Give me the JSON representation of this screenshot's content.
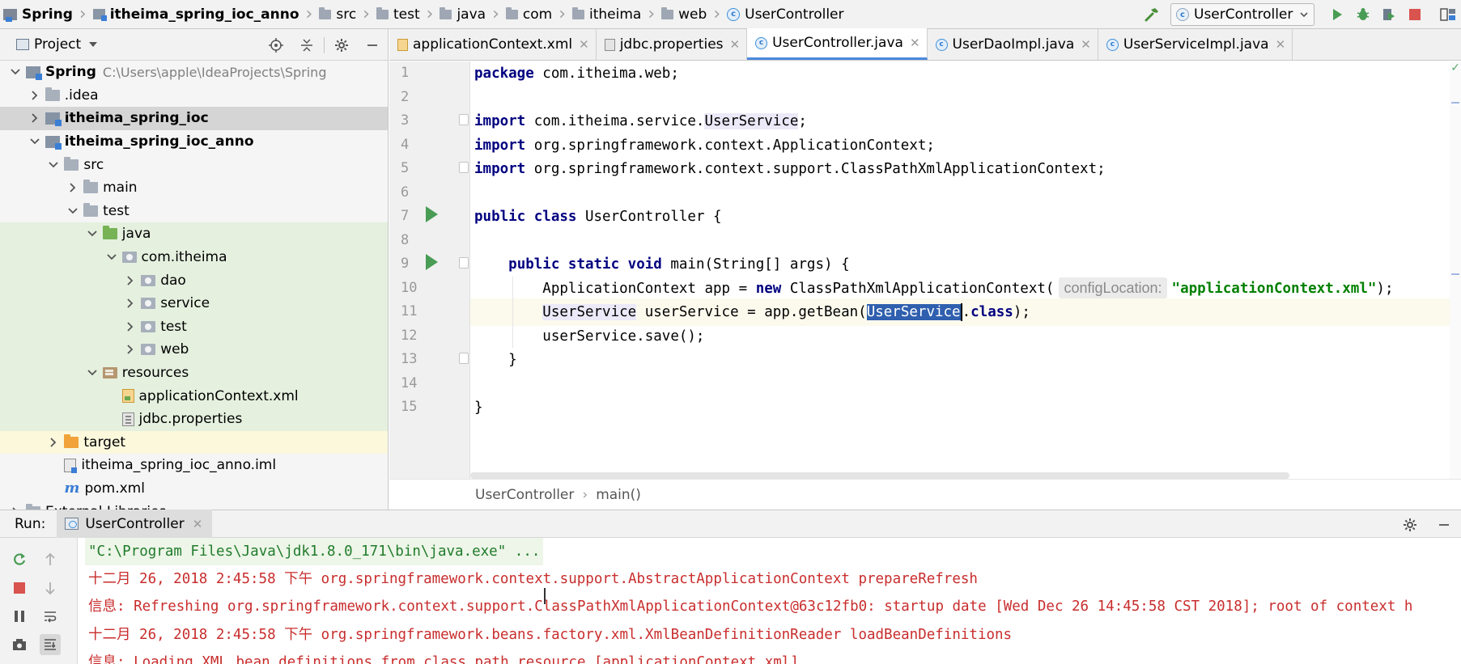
{
  "breadcrumbs": [
    {
      "label": "Spring",
      "bold": true,
      "icon": "spring-project-icon"
    },
    {
      "label": "itheima_spring_ioc_anno",
      "bold": true,
      "icon": "module-icon"
    },
    {
      "label": "src",
      "icon": "folder-icon"
    },
    {
      "label": "test",
      "icon": "folder-icon"
    },
    {
      "label": "java",
      "icon": "folder-icon"
    },
    {
      "label": "com",
      "icon": "folder-icon"
    },
    {
      "label": "itheima",
      "icon": "folder-icon"
    },
    {
      "label": "web",
      "icon": "folder-icon"
    },
    {
      "label": "UserController",
      "icon": "class-icon"
    }
  ],
  "run_config": {
    "selected": "UserController"
  },
  "project_panel": {
    "title": "Project"
  },
  "project_tree": [
    {
      "label": "Spring",
      "depth": 0,
      "expanded": true,
      "icon": "spring",
      "bold": true,
      "path": "C:\\Users\\apple\\IdeaProjects\\Spring"
    },
    {
      "label": ".idea",
      "depth": 1,
      "expanded": false,
      "icon": "grey"
    },
    {
      "label": "itheima_spring_ioc",
      "depth": 1,
      "expanded": false,
      "icon": "module",
      "bold": true,
      "state": "selected"
    },
    {
      "label": "itheima_spring_ioc_anno",
      "depth": 1,
      "expanded": true,
      "icon": "module",
      "bold": true
    },
    {
      "label": "src",
      "depth": 2,
      "expanded": true,
      "icon": "grey"
    },
    {
      "label": "main",
      "depth": 3,
      "expanded": false,
      "icon": "grey"
    },
    {
      "label": "test",
      "depth": 3,
      "expanded": true,
      "icon": "grey"
    },
    {
      "label": "java",
      "depth": 4,
      "expanded": true,
      "icon": "green",
      "state": "green"
    },
    {
      "label": "com.itheima",
      "depth": 5,
      "expanded": true,
      "icon": "pkg",
      "state": "green"
    },
    {
      "label": "dao",
      "depth": 6,
      "expanded": false,
      "icon": "pkg",
      "state": "green"
    },
    {
      "label": "service",
      "depth": 6,
      "expanded": false,
      "icon": "pkg",
      "state": "green"
    },
    {
      "label": "test",
      "depth": 6,
      "expanded": false,
      "icon": "pkg",
      "state": "green"
    },
    {
      "label": "web",
      "depth": 6,
      "expanded": false,
      "icon": "pkg",
      "state": "green"
    },
    {
      "label": "resources",
      "depth": 4,
      "expanded": true,
      "icon": "res",
      "state": "green"
    },
    {
      "label": "applicationContext.xml",
      "depth": 5,
      "icon": "xml",
      "state": "green"
    },
    {
      "label": "jdbc.properties",
      "depth": 5,
      "icon": "prop",
      "state": "green"
    },
    {
      "label": "target",
      "depth": 2,
      "expanded": false,
      "icon": "orange",
      "state": "yellow"
    },
    {
      "label": "itheima_spring_ioc_anno.iml",
      "depth": 2,
      "icon": "iml"
    },
    {
      "label": "pom.xml",
      "depth": 2,
      "icon": "maven"
    },
    {
      "label": "External Libraries",
      "depth": 0,
      "expanded": false,
      "icon": "grey"
    }
  ],
  "editor_tabs": [
    {
      "label": "applicationContext.xml",
      "icon": "xml"
    },
    {
      "label": "jdbc.properties",
      "icon": "prop"
    },
    {
      "label": "UserController.java",
      "icon": "class",
      "active": true
    },
    {
      "label": "UserDaoImpl.java",
      "icon": "class"
    },
    {
      "label": "UserServiceImpl.java",
      "icon": "class"
    }
  ],
  "line_numbers": [
    "1",
    "2",
    "3",
    "4",
    "5",
    "6",
    "7",
    "8",
    "9",
    "10",
    "11",
    "12",
    "13",
    "14",
    "15"
  ],
  "code_lines": [
    [
      {
        "t": "package",
        "c": "kw"
      },
      {
        "t": " com.itheima.web;"
      }
    ],
    [],
    [
      {
        "t": "import",
        "c": "kw"
      },
      {
        "t": " com.itheima.service."
      },
      {
        "t": "UserService",
        "c": "usage"
      },
      {
        "t": ";"
      }
    ],
    [
      {
        "t": "import",
        "c": "kw"
      },
      {
        "t": " org.springframework.context.ApplicationContext;"
      }
    ],
    [
      {
        "t": "import",
        "c": "kw"
      },
      {
        "t": " org.springframework.context.support.ClassPathXmlApplicationContext;"
      }
    ],
    [],
    [
      {
        "t": "public class",
        "c": "kw"
      },
      {
        "t": " UserController {"
      }
    ],
    [],
    [
      {
        "t": "    "
      },
      {
        "t": "public static void",
        "c": "kw"
      },
      {
        "t": " main(String[] args) {"
      }
    ],
    [
      {
        "t": "        ApplicationContext app = "
      },
      {
        "t": "new",
        "c": "kw"
      },
      {
        "t": " ClassPathXmlApplicationContext("
      },
      {
        "t": "configLocation:",
        "c": "hint"
      },
      {
        "t": "\"applicationContext.xml\"",
        "c": "str"
      },
      {
        "t": ");"
      }
    ],
    [
      {
        "t": "        "
      },
      {
        "t": "UserService",
        "c": "usage"
      },
      {
        "t": " userService = app.getBean("
      },
      {
        "t": "UserService",
        "c": "sel"
      },
      {
        "t": "",
        "c": "caret"
      },
      {
        "t": "."
      },
      {
        "t": "class",
        "c": "kw"
      },
      {
        "t": ");"
      }
    ],
    [
      {
        "t": "        userService.save();"
      }
    ],
    [
      {
        "t": "    }"
      }
    ],
    [],
    [
      {
        "t": "}"
      }
    ]
  ],
  "editor_breadcrumb": [
    "UserController",
    "main()"
  ],
  "run_panel": {
    "label": "Run:",
    "tab": "UserController"
  },
  "console_lines": [
    {
      "text": "\"C:\\Program Files\\Java\\jdk1.8.0_171\\bin\\java.exe\" ...",
      "kind": "cmd"
    },
    {
      "text": "十二月 26, 2018 2:45:58 下午 org.springframework.context.support.AbstractApplicationContext prepareRefresh",
      "kind": "err"
    },
    {
      "text": "信息: Refreshing org.springframework.context.support.ClassPathXmlApplicationContext@63c12fb0: startup date [Wed Dec 26 14:45:58 CST 2018]; root of context h",
      "kind": "err"
    },
    {
      "text": "十二月 26, 2018 2:45:58 下午 org.springframework.beans.factory.xml.XmlBeanDefinitionReader loadBeanDefinitions",
      "kind": "err"
    },
    {
      "text": "信息: Loading XML bean definitions from class path resource [applicationContext.xml]",
      "kind": "err"
    }
  ],
  "colors": {
    "keyword": "#000080",
    "string": "#008000",
    "selection": "#2f5fae",
    "console_text": "#c92d2d",
    "console_cmd": "#217b2c",
    "run_green": "#499c54",
    "stop_red": "#d9534f"
  }
}
